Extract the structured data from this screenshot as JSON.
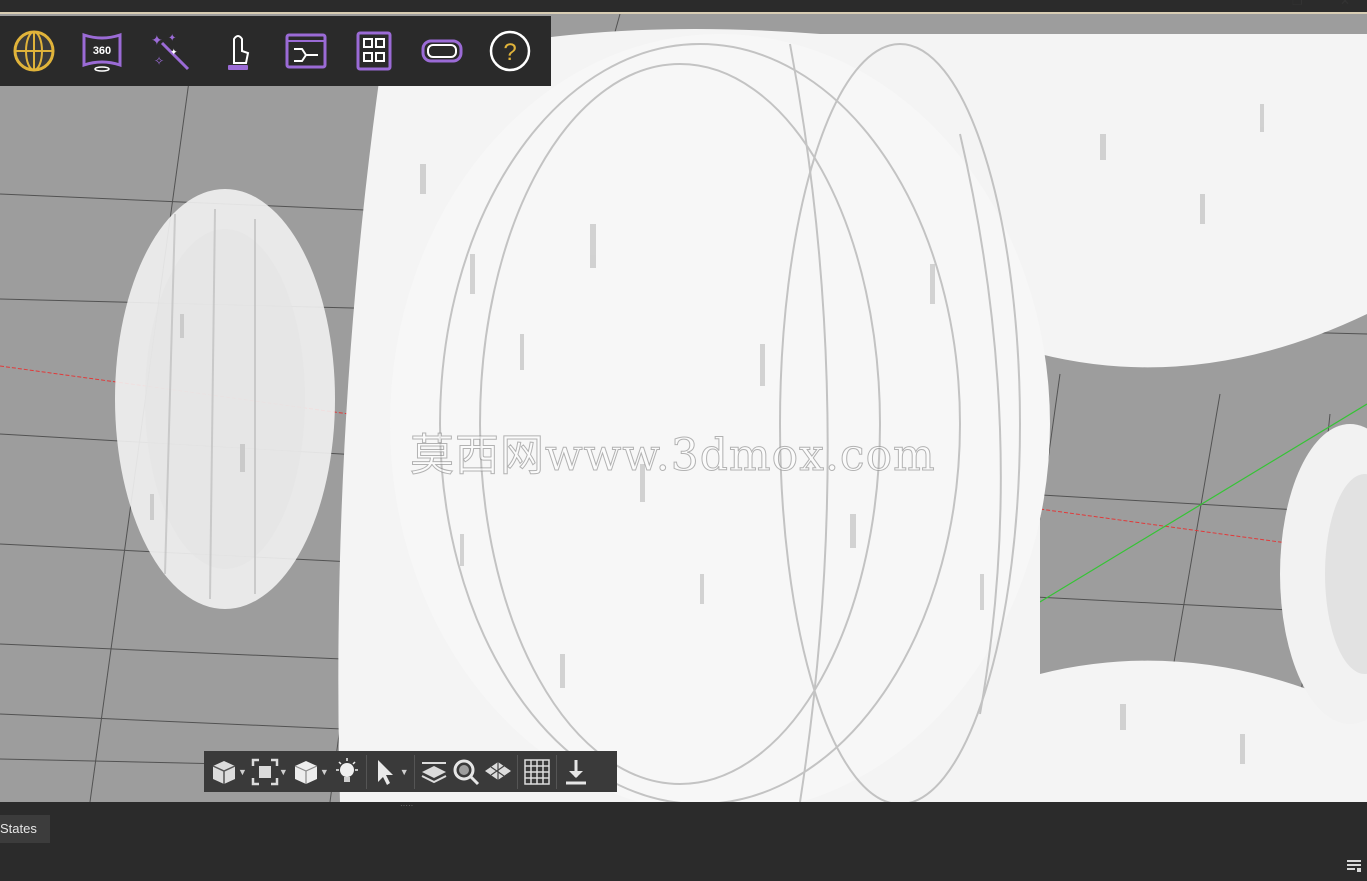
{
  "app": {
    "watermark": "莫西网www.3dmox.com"
  },
  "top_toolbar": {
    "buttons": [
      {
        "id": "globe",
        "icon": "globe-icon"
      },
      {
        "id": "360",
        "icon": "panorama-360-icon",
        "label": "360"
      },
      {
        "id": "magic",
        "icon": "magic-wand-icon"
      },
      {
        "id": "touch",
        "icon": "touch-pointer-icon"
      },
      {
        "id": "flow",
        "icon": "flow-panel-icon"
      },
      {
        "id": "grid",
        "icon": "grid-panel-icon"
      },
      {
        "id": "vr",
        "icon": "vr-headset-icon"
      },
      {
        "id": "help",
        "icon": "help-icon",
        "label": "?"
      }
    ]
  },
  "bottom_toolbar": {
    "buttons": [
      {
        "icon": "view-cube-icon"
      },
      {
        "icon": "zoom-extents-icon"
      },
      {
        "icon": "shaded-cube-icon"
      },
      {
        "icon": "light-bulb-icon"
      },
      {
        "icon": "select-arrow-icon"
      },
      {
        "icon": "layers-icon"
      },
      {
        "icon": "search-material-icon"
      },
      {
        "icon": "checker-plane-icon"
      },
      {
        "icon": "grid-icon"
      },
      {
        "icon": "download-icon"
      }
    ]
  },
  "panel": {
    "states_tab": "States"
  },
  "colors": {
    "viewport_bg": "#9d9d9d",
    "toolbar_bg": "#2a2a2a",
    "accent_purple": "#9b6bd6",
    "accent_gold": "#e0b33a",
    "axis_x": "#e03a3a",
    "axis_y": "#35c435"
  }
}
